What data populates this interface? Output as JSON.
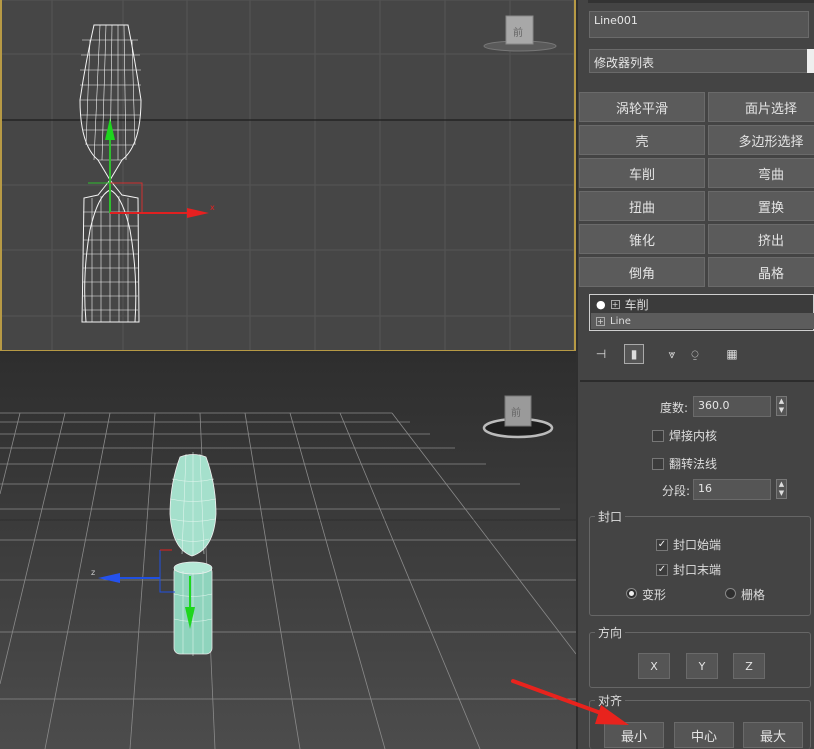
{
  "object_name": "Line001",
  "modifier_list": "修改器列表",
  "modifier_buttons": [
    "涡轮平滑",
    "面片选择",
    "壳",
    "多边形选择",
    "车削",
    "弯曲",
    "扭曲",
    "置换",
    "锥化",
    "挤出",
    "倒角",
    "晶格"
  ],
  "stack": {
    "items": [
      "车削",
      "Line"
    ]
  },
  "viewport": {
    "front_cube_label": "前",
    "persp_cube_label": "前",
    "axis_x": "x",
    "axis_z": "z"
  },
  "params": {
    "degrees_label": "度数:",
    "degrees_value": "360.0",
    "weld_core": "焊接内核",
    "flip_normals": "翻转法线",
    "segments_label": "分段:",
    "segments_value": "16"
  },
  "capping": {
    "title": "封口",
    "cap_start": "封口始端",
    "cap_end": "封口末端",
    "morph": "变形",
    "grid": "栅格"
  },
  "direction": {
    "title": "方向",
    "buttons": [
      "X",
      "Y",
      "Z"
    ]
  },
  "align": {
    "title": "对齐",
    "buttons": [
      "最小",
      "中心",
      "最大"
    ]
  },
  "colors": {
    "accent_border": "#b79a45",
    "annotation_arrow": "#e8231d",
    "object_fill": "#a5e0cc"
  }
}
